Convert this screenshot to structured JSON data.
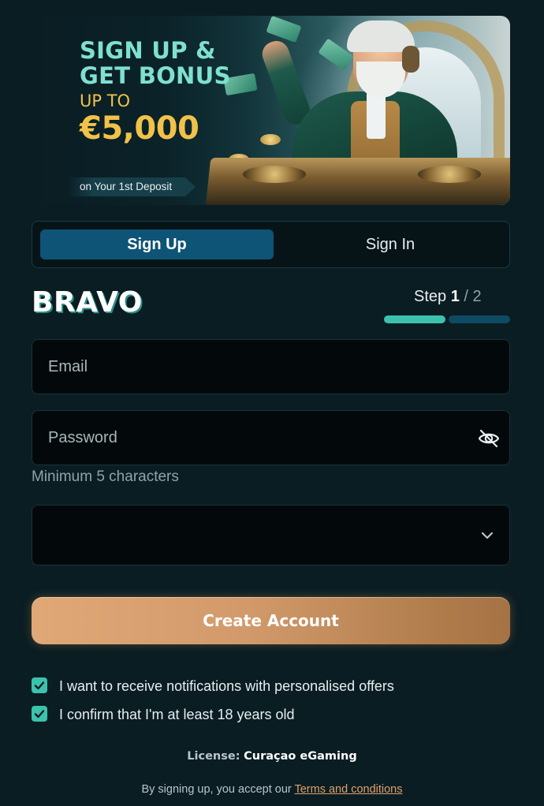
{
  "banner": {
    "headline_line1": "SIGN UP &",
    "headline_line2": "GET BONUS",
    "up_to": "UP TO",
    "amount": "€5,000",
    "deposit_note": "on Your 1st Deposit"
  },
  "tabs": {
    "signup_label": "Sign Up",
    "signin_label": "Sign In",
    "active": "Sign Up"
  },
  "brand": {
    "logo_text": "BRAVO"
  },
  "step": {
    "label": "Step",
    "current": "1",
    "separator": " / ",
    "total": "2"
  },
  "form": {
    "email_placeholder": "Email",
    "password_placeholder": "Password",
    "password_hint": "Minimum 5 characters",
    "select_value": "",
    "submit_label": "Create Account"
  },
  "checkboxes": [
    {
      "label": "I want to receive notifications with personalised offers",
      "checked": true
    },
    {
      "label": "I confirm that I'm at least 18 years old",
      "checked": true
    }
  ],
  "footer": {
    "license_key": "License:",
    "license_value": "Curaçao eGaming",
    "terms_prefix": "By signing up, you accept our ",
    "terms_link": "Terms and conditions"
  },
  "colors": {
    "background": "#0a1d23",
    "accent_teal": "#3cc2ac",
    "tab_active": "#0e5476",
    "button_gold": "#d29a6b",
    "link": "#e0a06a"
  },
  "icons": {
    "password_toggle": "eye-off-icon",
    "select_caret": "chevron-down-icon",
    "checkbox": "check-icon"
  }
}
